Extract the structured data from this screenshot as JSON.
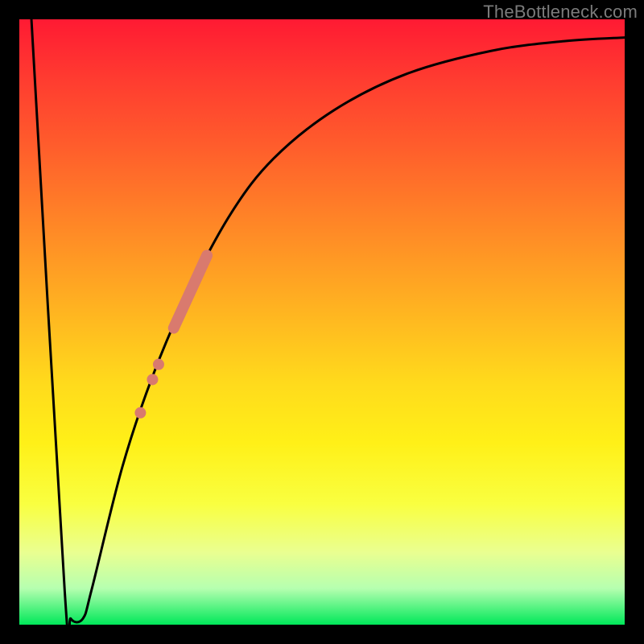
{
  "attribution": "TheBottleneck.com",
  "colors": {
    "frame": "#000000",
    "curve": "#000000",
    "dot_fill": "#d97a6e",
    "gradient_top": "#ff1a33",
    "gradient_bottom": "#00e859"
  },
  "chart_data": {
    "type": "line",
    "title": "",
    "xlabel": "",
    "ylabel": "",
    "xlim": [
      0,
      100
    ],
    "ylim": [
      0,
      100
    ],
    "grid": false,
    "legend": false,
    "curve": {
      "name": "bottleneck-curve",
      "points": [
        {
          "x": 2.0,
          "y": 100.0
        },
        {
          "x": 7.5,
          "y": 5.5
        },
        {
          "x": 8.5,
          "y": 1.0
        },
        {
          "x": 10.5,
          "y": 1.0
        },
        {
          "x": 12.0,
          "y": 6.0
        },
        {
          "x": 17.0,
          "y": 26.0
        },
        {
          "x": 22.0,
          "y": 41.0
        },
        {
          "x": 28.0,
          "y": 55.0
        },
        {
          "x": 35.0,
          "y": 68.0
        },
        {
          "x": 42.0,
          "y": 77.0
        },
        {
          "x": 52.0,
          "y": 85.0
        },
        {
          "x": 64.0,
          "y": 91.0
        },
        {
          "x": 78.0,
          "y": 94.8
        },
        {
          "x": 90.0,
          "y": 96.4
        },
        {
          "x": 100.0,
          "y": 97.0
        }
      ]
    },
    "highlight_band": {
      "name": "thick-segment",
      "thickness_px": 14,
      "points": [
        {
          "x": 25.5,
          "y": 49.0
        },
        {
          "x": 31.0,
          "y": 61.0
        }
      ]
    },
    "dots": {
      "name": "scatter-dots",
      "radius_px": 7,
      "points": [
        {
          "x": 20.0,
          "y": 35.0
        },
        {
          "x": 22.0,
          "y": 40.5
        },
        {
          "x": 23.0,
          "y": 43.0
        }
      ]
    }
  }
}
